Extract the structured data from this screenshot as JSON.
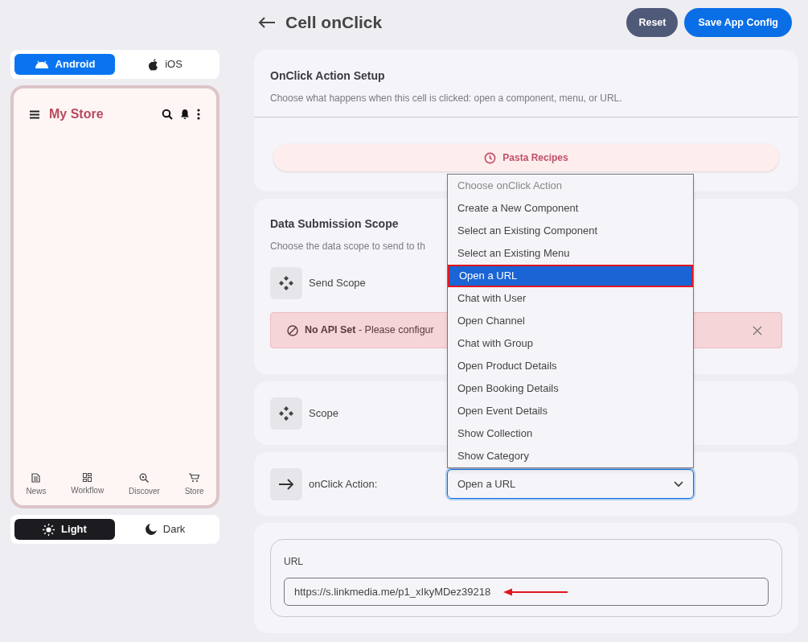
{
  "platform_tabs": [
    {
      "label": "Android",
      "kind": "android",
      "selected": true
    },
    {
      "label": "iOS",
      "kind": "ios",
      "selected": false
    }
  ],
  "phone": {
    "app_title": "My Store",
    "nav": [
      {
        "label": "News",
        "kind": "news"
      },
      {
        "label": "Workflow",
        "kind": "workflow"
      },
      {
        "label": "Discover",
        "kind": "discover"
      },
      {
        "label": "Store",
        "kind": "store"
      }
    ]
  },
  "theme_tabs": [
    {
      "label": "Light",
      "kind": "light",
      "selected": true
    },
    {
      "label": "Dark",
      "kind": "dark",
      "selected": false
    }
  ],
  "header": {
    "title": "Cell onClick",
    "buttons": [
      {
        "label": "Reset",
        "kind": "secondary"
      },
      {
        "label": "Save App Config",
        "kind": "primary"
      }
    ]
  },
  "setup": {
    "title": "OnClick Action Setup",
    "description": "Choose what happens when this cell is clicked: open a component, menu, or URL.",
    "preview_chip": "Pasta Recipes"
  },
  "submission": {
    "title": "Data Submission Scope",
    "description": "Choose the data scope to send to th",
    "row_label": "Send Scope",
    "alert": "**No API Set** - Please configur"
  },
  "scope_row": {
    "label": "Scope"
  },
  "action": {
    "label": "onClick Action:",
    "value": "Open a URL",
    "expanded": true,
    "options": [
      {
        "label": "Choose onClick Action",
        "disabled": true,
        "selected": false
      },
      {
        "label": "Create a New Component",
        "disabled": false,
        "selected": false
      },
      {
        "label": "Select an Existing Component",
        "disabled": false,
        "selected": false
      },
      {
        "label": "Select an Existing Menu",
        "disabled": false,
        "selected": false
      },
      {
        "label": "Open a URL",
        "disabled": false,
        "selected": true
      },
      {
        "label": "Chat with User",
        "disabled": false,
        "selected": false
      },
      {
        "label": "Open Channel",
        "disabled": false,
        "selected": false
      },
      {
        "label": "Chat with Group",
        "disabled": false,
        "selected": false
      },
      {
        "label": "Open Product Details",
        "disabled": false,
        "selected": false
      },
      {
        "label": "Open Booking Details",
        "disabled": false,
        "selected": false
      },
      {
        "label": "Open Event Details",
        "disabled": false,
        "selected": false
      },
      {
        "label": "Show Collection",
        "disabled": false,
        "selected": false
      },
      {
        "label": "Show Category",
        "disabled": false,
        "selected": false
      }
    ]
  },
  "url": {
    "label": "URL",
    "value": "https://s.linkmedia.me/p1_xIkyMDez39218"
  }
}
